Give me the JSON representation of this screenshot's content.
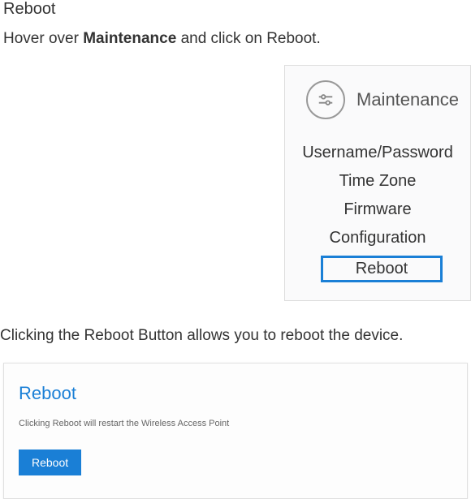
{
  "page_title": "Reboot",
  "instruction_prefix": "Hover over ",
  "instruction_bold": "Maintenance",
  "instruction_suffix": " and click on Reboot.",
  "menu": {
    "header_label": "Maintenance",
    "items": [
      {
        "label": "Username/Password",
        "selected": false
      },
      {
        "label": "Time Zone",
        "selected": false
      },
      {
        "label": "Firmware",
        "selected": false
      },
      {
        "label": "Configuration",
        "selected": false
      },
      {
        "label": "Reboot",
        "selected": true
      }
    ]
  },
  "post_instruction": "Clicking the Reboot Button allows you to reboot the device.",
  "reboot_panel": {
    "title": "Reboot",
    "description": "Clicking Reboot will restart the Wireless Access Point",
    "button_label": "Reboot"
  }
}
